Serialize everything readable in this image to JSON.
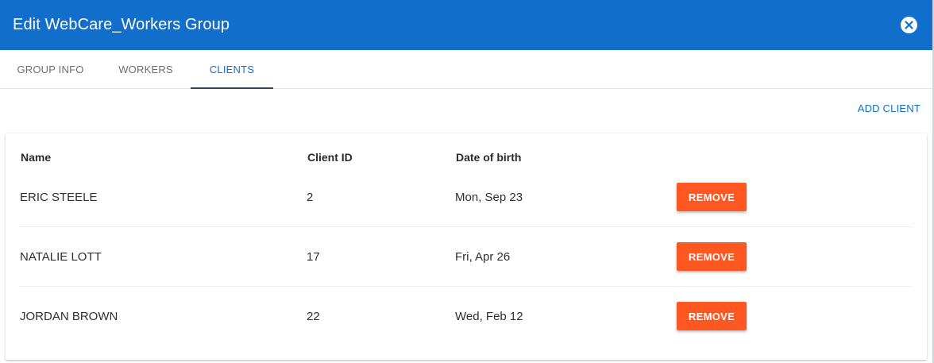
{
  "header": {
    "title": "Edit WebCare_Workers Group",
    "close_icon": "close-circle-icon"
  },
  "tabs": [
    {
      "label": "GROUP INFO",
      "active": false
    },
    {
      "label": "WORKERS",
      "active": false
    },
    {
      "label": "CLIENTS",
      "active": true
    }
  ],
  "actions": {
    "add_client_label": "ADD CLIENT"
  },
  "table": {
    "columns": [
      "Name",
      "Client ID",
      "Date of birth"
    ],
    "rows": [
      {
        "name": "ERIC STEELE",
        "client_id": "2",
        "dob": "Mon, Sep 23",
        "action_label": "REMOVE"
      },
      {
        "name": "NATALIE LOTT",
        "client_id": "17",
        "dob": "Fri, Apr 26",
        "action_label": "REMOVE"
      },
      {
        "name": "JORDAN BROWN",
        "client_id": "22",
        "dob": "Wed, Feb 12",
        "action_label": "REMOVE"
      }
    ]
  },
  "colors": {
    "header_bg": "#116ecb",
    "accent": "#116ecb",
    "remove_button": "#ff5722"
  }
}
